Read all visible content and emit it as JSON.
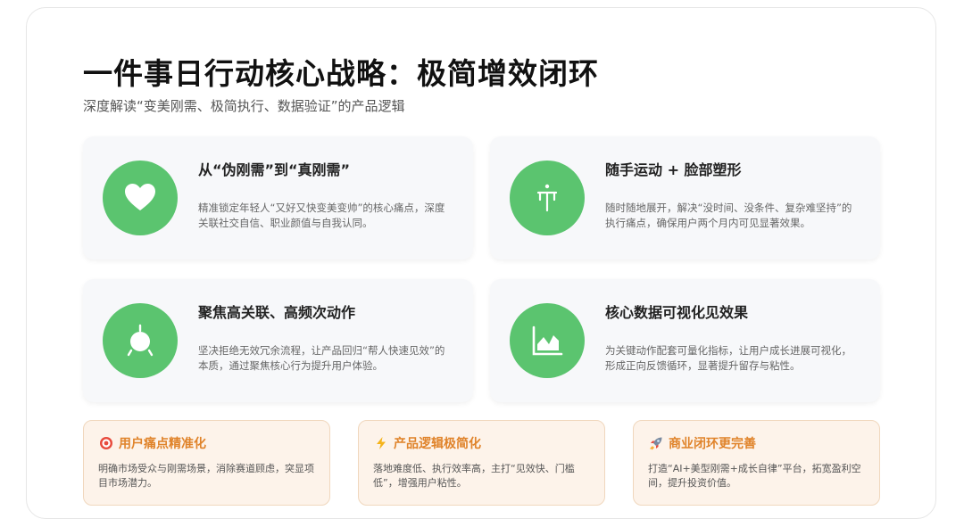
{
  "header": {
    "title": "一件事日行动核心战略：极简增效闭环",
    "subtitle": "深度解读“变美刚需、极简执行、数据验证”的产品逻辑"
  },
  "cards": [
    {
      "icon": "heart-icon",
      "title": "从“伪刚需”到“真刚需”",
      "desc": "精准锁定年轻人“又好又快变美变帅”的核心痛点，深度关联社交自信、职业颜值与自我认同。"
    },
    {
      "icon": "person-exercise-icon",
      "title": "随手运动 + 脸部塑形",
      "desc": "随时随地展开，解决“没时间、没条件、复杂难坚持”的执行痛点，确保用户两个月内可见显著效果。"
    },
    {
      "icon": "target-icon",
      "title": "聚焦高关联、高频次动作",
      "desc": "坚决拒绝无效冗余流程，让产品回归“帮人快速见效”的本质，通过聚焦核心行为提升用户体验。"
    },
    {
      "icon": "chart-area-icon",
      "title": "核心数据可视化见效果",
      "desc": "为关键动作配套可量化指标，让用户成长进展可视化，形成正向反馈循环，显著提升留存与粘性。"
    }
  ],
  "tips": [
    {
      "icon": "bullseye-icon",
      "title": "用户痛点精准化",
      "desc": "明确市场受众与刚需场景，消除赛道顾虑，突显项目市场潜力。"
    },
    {
      "icon": "lightning-icon",
      "title": "产品逻辑极简化",
      "desc": "落地难度低、执行效率高，主打“见效快、门槛低”，增强用户粘性。"
    },
    {
      "icon": "rocket-icon",
      "title": "商业闭环更完善",
      "desc": "打造“AI+美型刚需+成长自律”平台，拓宽盈利空间，提升投资价值。"
    }
  ],
  "colors": {
    "accent_green": "#5bc46f",
    "tip_orange": "#e0832a",
    "tip_bg": "#fdf3ea"
  }
}
